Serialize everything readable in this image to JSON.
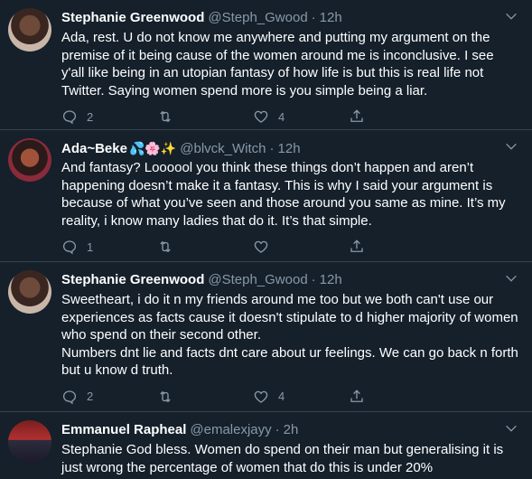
{
  "tweets": [
    {
      "name": "Stephanie Greenwood",
      "handle": "@Steph_Gwood",
      "sep": "·",
      "time": "12h",
      "text": "Ada, rest. U do not know me anywhere and putting my argument on the premise of it being cause of the women around me is inconclusive. I see y'all like being in an utopian fantasy of how life is but this is real life not Twitter. Saying women spend more is you simple being a liar.",
      "replies": "2",
      "retweets": "",
      "likes": "4"
    },
    {
      "name": "Ada~Beke",
      "name_emoji": "💦🌸✨",
      "handle": "@blvck_Witch",
      "sep": "·",
      "time": "12h",
      "text": "And fantasy? Loooool you think these things don’t happen and aren’t happening doesn’t make it a fantasy. This is why I said your argument is because of what you’ve seen and those around you same as mine. It’s my reality, i know many ladies that do it. It’s that simple.",
      "replies": "1",
      "retweets": "",
      "likes": ""
    },
    {
      "name": "Stephanie Greenwood",
      "handle": "@Steph_Gwood",
      "sep": "·",
      "time": "12h",
      "text": "Sweetheart, i do it n my friends around me too but we both can't use our experiences as facts cause it doesn't stipulate to d higher majority of women who spend on their second other.\nNumbers dnt lie and facts dnt care about ur feelings. We can go back n forth but u know d truth.",
      "replies": "2",
      "retweets": "",
      "likes": "4"
    },
    {
      "name": "Emmanuel Rapheal",
      "handle": "@emalexjayy",
      "sep": "·",
      "time": "2h",
      "text": "Stephanie God bless. Women do spend on their man but generalising it is just wrong the percentage of women that do this is under 20%"
    }
  ],
  "colors": {
    "background": "#15202b",
    "text": "#ffffff",
    "muted": "#8899a6",
    "divider": "#38444d"
  }
}
